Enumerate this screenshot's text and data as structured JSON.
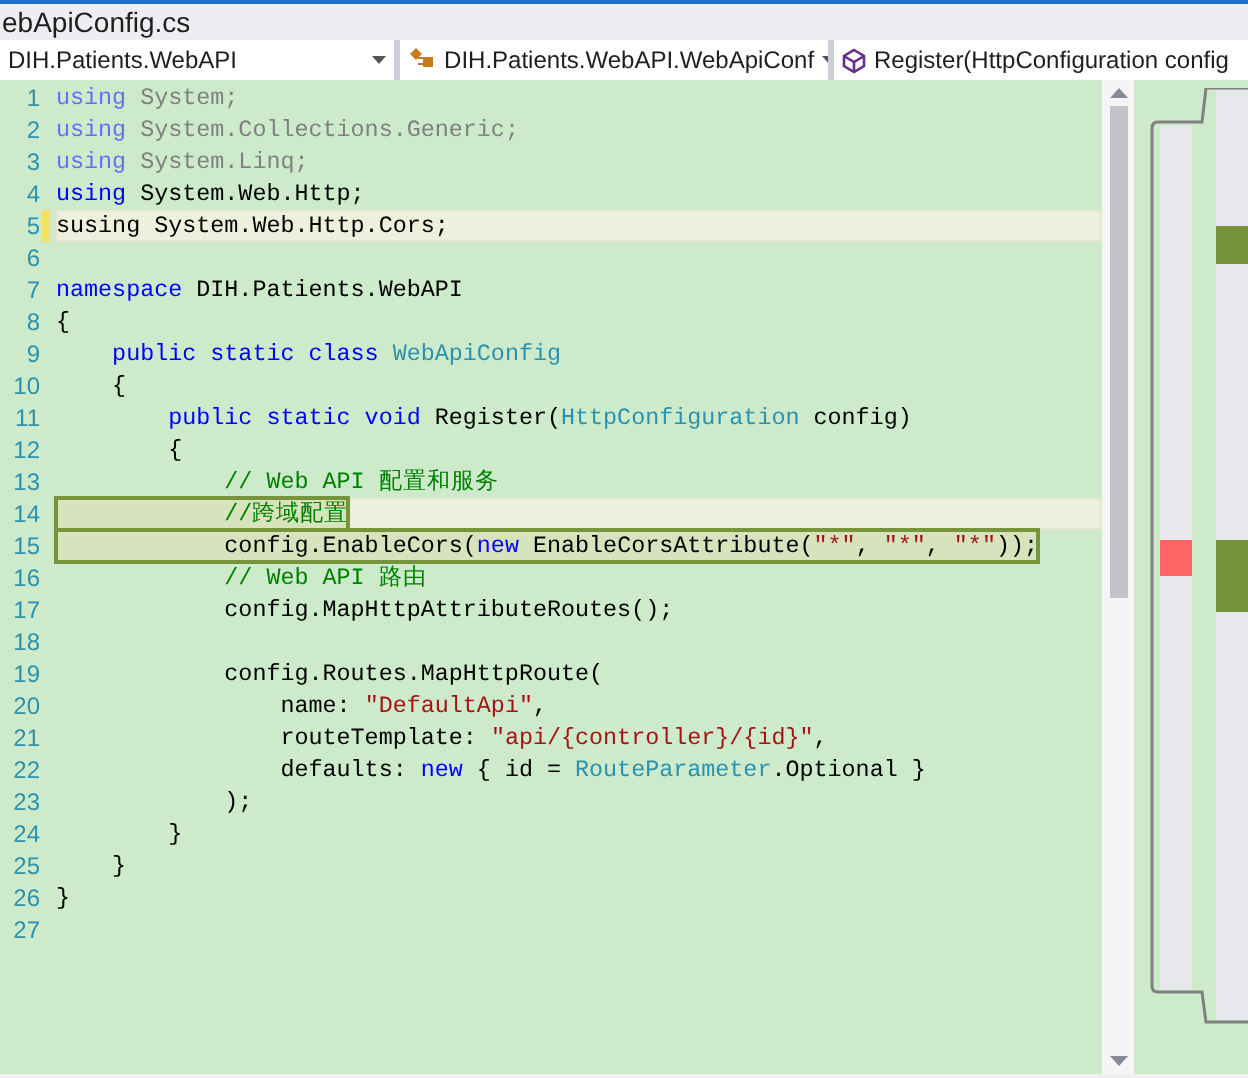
{
  "tab": {
    "title": "ebApiConfig.cs"
  },
  "navigation": [
    {
      "kind": "project",
      "label": "DIH.Patients.WebAPI"
    },
    {
      "kind": "class",
      "label": "DIH.Patients.WebAPI.WebApiConf"
    },
    {
      "kind": "member",
      "label": "Register(HttpConfiguration config"
    }
  ],
  "lines": [
    {
      "number": "1",
      "highlight": false,
      "boxed": false,
      "changed": false,
      "tokens": [
        {
          "kind": "faded-keyword",
          "text": "using"
        },
        {
          "kind": "faded",
          "text": " System;"
        }
      ]
    },
    {
      "number": "2",
      "highlight": false,
      "boxed": false,
      "changed": false,
      "tokens": [
        {
          "kind": "faded-keyword",
          "text": "using"
        },
        {
          "kind": "faded",
          "text": " System.Collections.Generic;"
        }
      ]
    },
    {
      "number": "3",
      "highlight": false,
      "boxed": false,
      "changed": false,
      "tokens": [
        {
          "kind": "faded-keyword",
          "text": "using"
        },
        {
          "kind": "faded",
          "text": " System.Linq;"
        }
      ]
    },
    {
      "number": "4",
      "highlight": false,
      "boxed": false,
      "changed": false,
      "tokens": [
        {
          "kind": "keyword",
          "text": "using"
        },
        {
          "kind": "plain",
          "text": " System.Web.Http;"
        }
      ]
    },
    {
      "number": "5",
      "highlight": true,
      "boxed": false,
      "changed": true,
      "tokens": [
        {
          "kind": "plain",
          "text": "susing System.Web.Http.Cors;"
        }
      ]
    },
    {
      "number": "6",
      "highlight": false,
      "boxed": false,
      "changed": false
    },
    {
      "number": "7",
      "highlight": false,
      "boxed": false,
      "changed": false,
      "tokens": [
        {
          "kind": "keyword",
          "text": "namespace"
        },
        {
          "kind": "plain",
          "text": " DIH.Patients.WebAPI"
        }
      ]
    },
    {
      "number": "8",
      "highlight": false,
      "boxed": false,
      "changed": false,
      "tokens": [
        {
          "kind": "plain",
          "text": "{"
        }
      ]
    },
    {
      "number": "9",
      "highlight": false,
      "boxed": false,
      "changed": false,
      "tokens": [
        {
          "kind": "keyword",
          "text": "    public static class"
        },
        {
          "kind": "type",
          "text": " WebApiConfig"
        }
      ]
    },
    {
      "number": "10",
      "highlight": false,
      "boxed": false,
      "changed": false,
      "tokens": [
        {
          "kind": "plain",
          "text": "    {"
        }
      ]
    },
    {
      "number": "11",
      "highlight": false,
      "boxed": false,
      "changed": false,
      "tokens": [
        {
          "kind": "keyword",
          "text": "        public static void"
        },
        {
          "kind": "plain",
          "text": " Register("
        },
        {
          "kind": "type",
          "text": "HttpConfiguration"
        },
        {
          "kind": "plain",
          "text": " config)"
        }
      ]
    },
    {
      "number": "12",
      "highlight": false,
      "boxed": false,
      "changed": false,
      "tokens": [
        {
          "kind": "plain",
          "text": "        {"
        }
      ]
    },
    {
      "number": "13",
      "highlight": false,
      "boxed": false,
      "changed": false,
      "tokens": [
        {
          "kind": "comment",
          "text": "            // Web API 配置和服务"
        }
      ]
    },
    {
      "number": "14",
      "highlight": true,
      "boxed": true,
      "changed": false,
      "tokens": [
        {
          "kind": "comment",
          "text": "            //跨域配置"
        }
      ]
    },
    {
      "number": "15",
      "highlight": false,
      "boxed": true,
      "changed": false,
      "tokens": [
        {
          "kind": "plain",
          "text": "            config.EnableCors("
        },
        {
          "kind": "keyword",
          "text": "new"
        },
        {
          "kind": "plain",
          "text": " EnableCorsAttribute("
        },
        {
          "kind": "string",
          "text": "\"*\""
        },
        {
          "kind": "plain",
          "text": ", "
        },
        {
          "kind": "string",
          "text": "\"*\""
        },
        {
          "kind": "plain",
          "text": ", "
        },
        {
          "kind": "string",
          "text": "\"*\""
        },
        {
          "kind": "plain",
          "text": "));"
        }
      ]
    },
    {
      "number": "16",
      "highlight": false,
      "boxed": false,
      "changed": false,
      "tokens": [
        {
          "kind": "comment",
          "text": "            // Web API 路由"
        }
      ]
    },
    {
      "number": "17",
      "highlight": false,
      "boxed": false,
      "changed": false,
      "tokens": [
        {
          "kind": "plain",
          "text": "            config.MapHttpAttributeRoutes();"
        }
      ]
    },
    {
      "number": "18",
      "highlight": false,
      "boxed": false,
      "changed": false
    },
    {
      "number": "19",
      "highlight": false,
      "boxed": false,
      "changed": false,
      "tokens": [
        {
          "kind": "plain",
          "text": "            config.Routes.MapHttpRoute("
        }
      ]
    },
    {
      "number": "20",
      "highlight": false,
      "boxed": false,
      "changed": false,
      "tokens": [
        {
          "kind": "plain",
          "text": "                name: "
        },
        {
          "kind": "string",
          "text": "\"DefaultApi\""
        },
        {
          "kind": "plain",
          "text": ","
        }
      ]
    },
    {
      "number": "21",
      "highlight": false,
      "boxed": false,
      "changed": false,
      "tokens": [
        {
          "kind": "plain",
          "text": "                routeTemplate: "
        },
        {
          "kind": "string",
          "text": "\"api/{controller}/{id}\""
        },
        {
          "kind": "plain",
          "text": ","
        }
      ]
    },
    {
      "number": "22",
      "highlight": false,
      "boxed": false,
      "changed": false,
      "tokens": [
        {
          "kind": "plain",
          "text": "                defaults: "
        },
        {
          "kind": "keyword",
          "text": "new"
        },
        {
          "kind": "plain",
          "text": " { id = "
        },
        {
          "kind": "type",
          "text": "RouteParameter"
        },
        {
          "kind": "plain",
          "text": ".Optional }"
        }
      ]
    },
    {
      "number": "23",
      "highlight": false,
      "boxed": false,
      "changed": false,
      "tokens": [
        {
          "kind": "plain",
          "text": "            );"
        }
      ]
    },
    {
      "number": "24",
      "highlight": false,
      "boxed": false,
      "changed": false,
      "tokens": [
        {
          "kind": "plain",
          "text": "        }"
        }
      ]
    },
    {
      "number": "25",
      "highlight": false,
      "boxed": false,
      "changed": false,
      "tokens": [
        {
          "kind": "plain",
          "text": "    }"
        }
      ]
    },
    {
      "number": "26",
      "highlight": false,
      "boxed": false,
      "changed": false,
      "tokens": [
        {
          "kind": "plain",
          "text": "}"
        }
      ]
    },
    {
      "number": "27",
      "highlight": false,
      "boxed": false,
      "changed": false
    }
  ]
}
